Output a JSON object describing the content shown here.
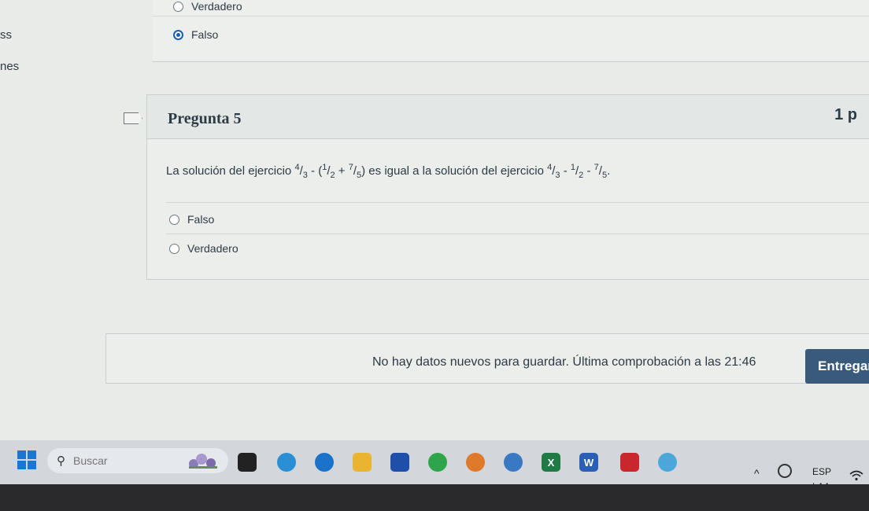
{
  "sidebar": {
    "fragment_1": "ss",
    "fragment_2": "nes"
  },
  "previous_question": {
    "options": [
      {
        "label": "Verdadero",
        "selected": false
      },
      {
        "label": "Falso",
        "selected": true
      }
    ]
  },
  "question": {
    "title": "Pregunta 5",
    "points": "1 p",
    "text_prefix": "La solución del ejercicio ",
    "text_middle": " es igual a la solución del ejercicio ",
    "text_suffix": ".",
    "expr1": {
      "a_num": "4",
      "a_den": "3",
      "b_num": "1",
      "b_den": "2",
      "c_num": "7",
      "c_den": "5"
    },
    "expr2": {
      "a_num": "4",
      "a_den": "3",
      "b_num": "1",
      "b_den": "2",
      "c_num": "7",
      "c_den": "5"
    },
    "options": [
      {
        "label": "Falso",
        "selected": false
      },
      {
        "label": "Verdadero",
        "selected": false
      }
    ]
  },
  "footer": {
    "message": "No hay datos nuevos para guardar. Última comprobación a las 21:46",
    "submit_label": "Entregar"
  },
  "taskbar": {
    "search_placeholder": "Buscar",
    "language": "ESP",
    "layout": "LAA",
    "chevron": "^"
  },
  "colors": {
    "accent": "#1a5fb4",
    "button": "#3a5a7c",
    "background": "#e9ebe8"
  }
}
